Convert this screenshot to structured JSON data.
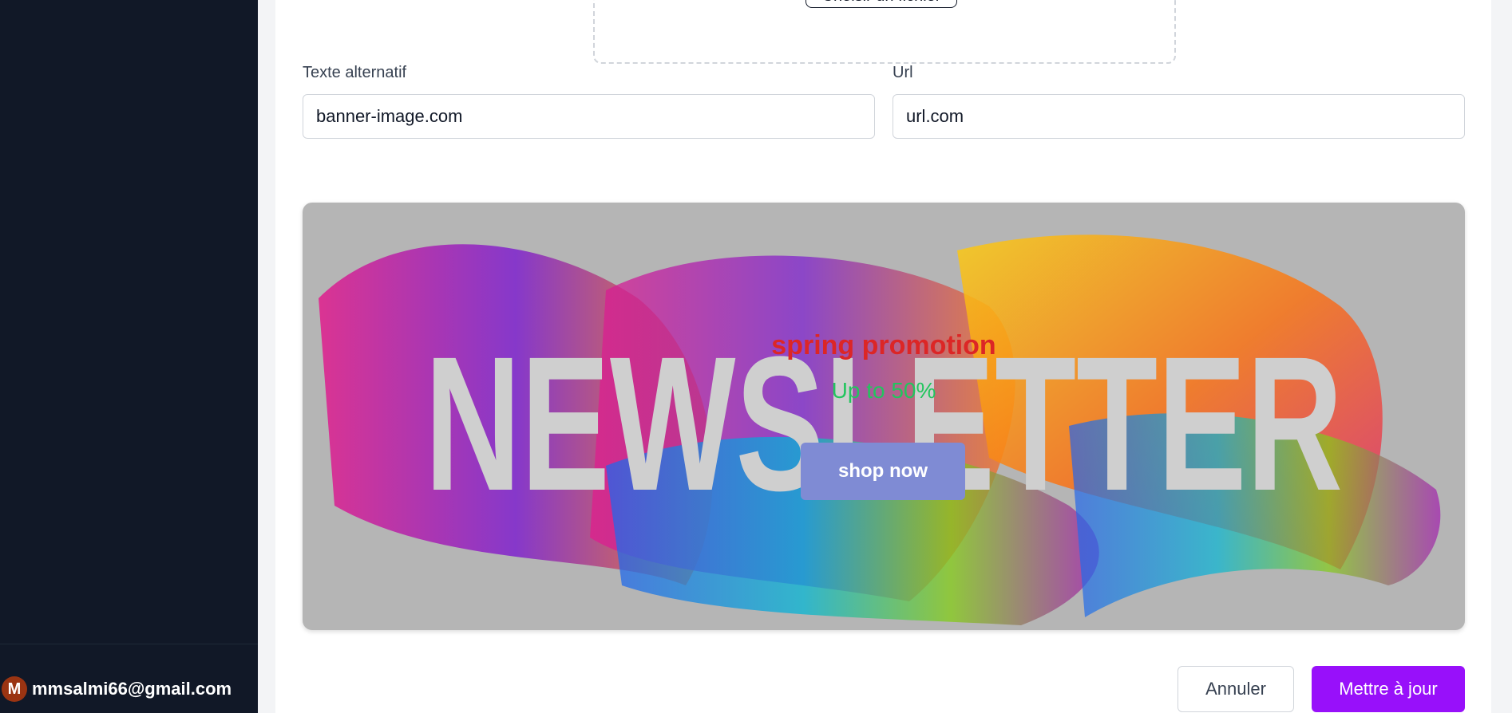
{
  "sidebar": {
    "user": {
      "initial": "M",
      "email": "mmsalmi66@gmail.com"
    }
  },
  "form": {
    "file_button_label": "Choisir un fichier",
    "alt_text": {
      "label": "Texte alternatif",
      "value": "banner-image.com"
    },
    "url": {
      "label": "Url",
      "value": "url.com"
    }
  },
  "banner": {
    "image_text": "NEWSLETTER",
    "title": "spring promotion",
    "subtitle": "Up to 50%",
    "button_label": "shop now"
  },
  "actions": {
    "cancel_label": "Annuler",
    "update_label": "Mettre à jour"
  },
  "colors": {
    "sidebar_bg": "#111827",
    "accent": "#9810fa",
    "banner_title": "#dc2626",
    "banner_subtitle": "#22c55e",
    "banner_button": "#7f8bd4",
    "avatar": "#9a3412"
  },
  "icons": {
    "avatar": "user-avatar"
  }
}
